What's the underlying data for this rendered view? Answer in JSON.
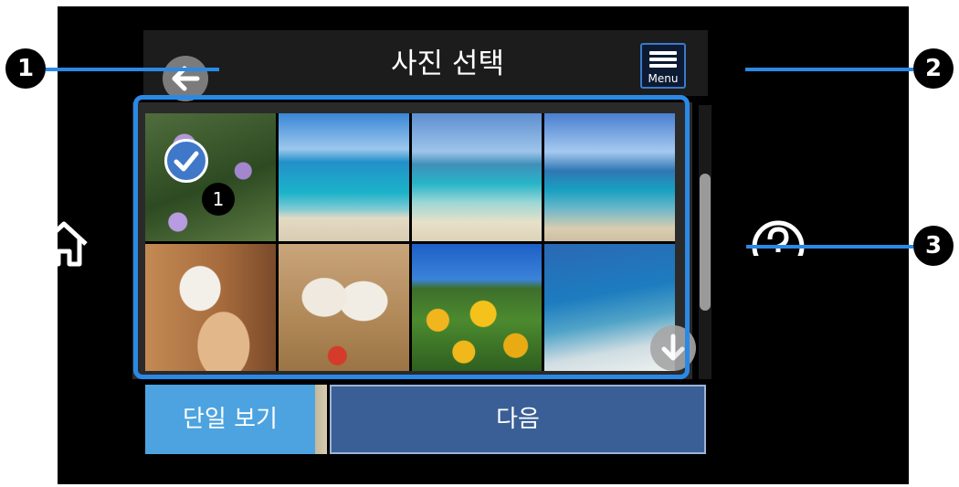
{
  "header": {
    "title": "사진 선택",
    "menu_label": "Menu"
  },
  "icons": {
    "back": "back-arrow-icon",
    "menu": "menu-icon",
    "home": "home-icon",
    "help": "help-icon",
    "check": "check-icon",
    "scroll_down": "chevron-down-icon"
  },
  "photos": [
    {
      "subject": "flowers",
      "selected": true,
      "count": "1"
    },
    {
      "subject": "sea"
    },
    {
      "subject": "beach"
    },
    {
      "subject": "coast"
    },
    {
      "subject": "puppies"
    },
    {
      "subject": "puppies-ball"
    },
    {
      "subject": "sunflowers"
    },
    {
      "subject": "shore"
    }
  ],
  "buttons": {
    "single_view": "단일 보기",
    "next": "다음"
  },
  "callouts": [
    "1",
    "2",
    "3"
  ],
  "colors": {
    "accent": "#2b89e6",
    "next_button": "#3a5f96",
    "single_view_button": "#4da3df"
  }
}
